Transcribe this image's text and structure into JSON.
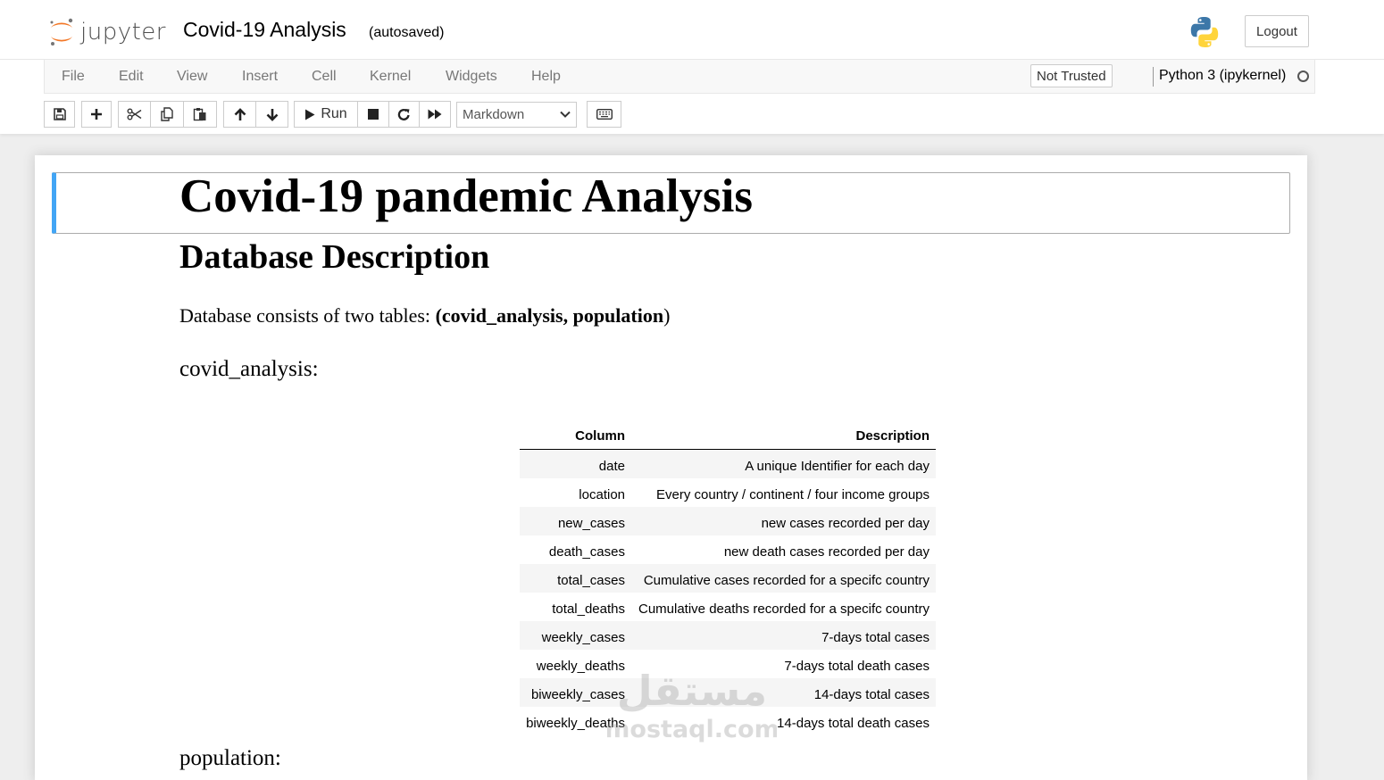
{
  "header": {
    "logo_text": "jupyter",
    "notebook_title": "Covid-19 Analysis",
    "autosave_status": "(autosaved)",
    "logout_label": "Logout"
  },
  "menubar": {
    "items": [
      "File",
      "Edit",
      "View",
      "Insert",
      "Cell",
      "Kernel",
      "Widgets",
      "Help"
    ],
    "trust_status": "Not Trusted",
    "kernel_name": "Python 3 (ipykernel)"
  },
  "toolbar": {
    "buttons": [
      "save-icon",
      "plus-icon",
      "scissors-icon",
      "copy-icon",
      "paste-icon",
      "arrow-up-icon",
      "arrow-down-icon",
      "run-icon",
      "stop-icon",
      "restart-icon",
      "fast-forward-icon",
      "keyboard-icon"
    ],
    "run_label": "Run",
    "cell_type": "Markdown"
  },
  "notebook": {
    "h1": "Covid-19 pandemic Analysis",
    "h2": "Database Description",
    "desc_prefix": "Database consists of two tables: ",
    "desc_open": "(",
    "desc_bold": "covid_analysis, population",
    "desc_close": ")",
    "covid_heading": "covid_analysis:",
    "next_heading_partial": "population:",
    "table": {
      "headers": [
        "Column",
        "Description"
      ],
      "rows": [
        [
          "date",
          "A unique Identifier for each day"
        ],
        [
          "location",
          "Every country / continent / four income groups"
        ],
        [
          "new_cases",
          "new cases recorded per day"
        ],
        [
          "death_cases",
          "new death cases recorded per day"
        ],
        [
          "total_cases",
          "Cumulative cases recorded for a specifc country"
        ],
        [
          "total_deaths",
          "Cumulative deaths recorded for a specifc country"
        ],
        [
          "weekly_cases",
          "7-days total cases"
        ],
        [
          "weekly_deaths",
          "7-days total death cases"
        ],
        [
          "biweekly_cases",
          "14-days total cases"
        ],
        [
          "biweekly_deaths",
          "14-days total death cases"
        ]
      ]
    }
  },
  "watermark": {
    "arabic": "مستقل",
    "latin": "mostaql.com"
  },
  "colors": {
    "selected_cell_border": "#42a5f5",
    "jupyter_orange": "#f37726",
    "python_blue": "#3c77a8",
    "python_yellow": "#ffd43b"
  }
}
